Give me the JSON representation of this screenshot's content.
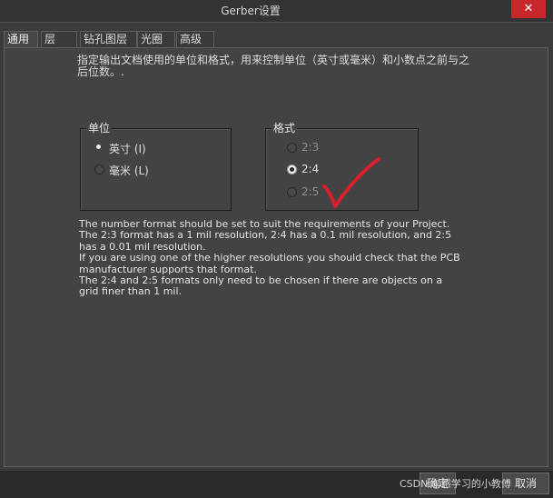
{
  "window": {
    "title": "Gerber设置",
    "close_glyph": "✕"
  },
  "tabs": [
    {
      "label": "通用"
    },
    {
      "label": "层"
    },
    {
      "label": "钻孔图层"
    },
    {
      "label": "光圈"
    },
    {
      "label": "高级"
    }
  ],
  "general": {
    "description": "指定输出文档使用的单位和格式，用来控制单位（英寸或毫米）和小数点之前与之后位数。.",
    "units": {
      "title": "单位",
      "options": [
        {
          "label": "英寸 (I)",
          "checked": true
        },
        {
          "label": "毫米 (L)",
          "checked": false
        }
      ]
    },
    "format": {
      "title": "格式",
      "options": [
        {
          "label": "2:3",
          "checked": false
        },
        {
          "label": "2:4",
          "checked": true
        },
        {
          "label": "2:5",
          "checked": false
        }
      ]
    },
    "info_lines": [
      "The number format should be set to suit the requirements of your Project.",
      "The 2:3 format has a 1 mil resolution, 2:4 has a 0.1 mil resolution, and 2:5 has a 0.01 mil resolution.",
      "If you are using one of the higher resolutions you should check that the PCB manufacturer supports that format.",
      "The 2:4 and 2:5 formats only need to be chosen if there are objects on a grid finer than 1 mil."
    ]
  },
  "footer": {
    "ok_label": "确定",
    "cancel_label": "取消",
    "watermark": "CSDN @感学习的小教傅"
  },
  "colors": {
    "annotation_check": "#d8202a",
    "close_button": "#c8282b"
  }
}
